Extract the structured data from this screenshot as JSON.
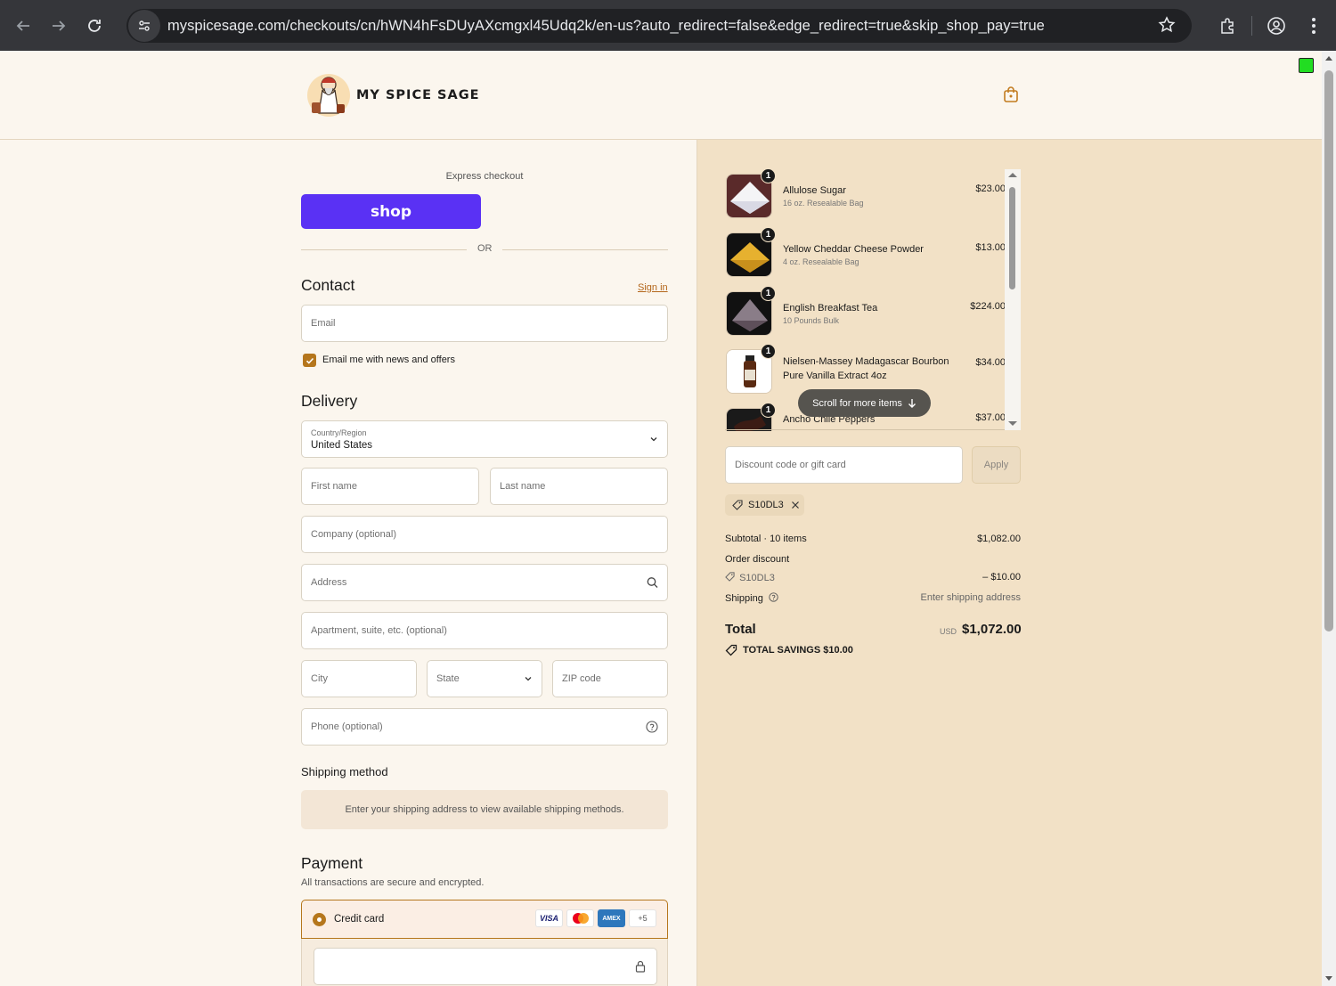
{
  "browser": {
    "url": "myspicesage.com/checkouts/cn/hWN4hFsDUyAXcmgxl45Udq2k/en-us?auto_redirect=false&edge_redirect=true&skip_shop_pay=true"
  },
  "header": {
    "logo_text": "MY SPICE SAGE",
    "cart_icon": "shopping-bag-icon"
  },
  "express": {
    "label": "Express checkout",
    "shop_button": "shop",
    "or": "OR"
  },
  "contact": {
    "title": "Contact",
    "sign_in": "Sign in",
    "email_placeholder": "Email",
    "newsletter_label": "Email me with news and offers",
    "newsletter_checked": true
  },
  "delivery": {
    "title": "Delivery",
    "country_label": "Country/Region",
    "country_value": "United States",
    "first_name": "First name",
    "last_name": "Last name",
    "company": "Company (optional)",
    "address": "Address",
    "apartment": "Apartment, suite, etc. (optional)",
    "city": "City",
    "state": "State",
    "zip": "ZIP code",
    "phone": "Phone (optional)"
  },
  "shipping_method": {
    "title": "Shipping method",
    "info": "Enter your shipping address to view available shipping methods."
  },
  "payment": {
    "title": "Payment",
    "subtitle": "All transactions are secure and encrypted.",
    "credit_card_label": "Credit card",
    "cards": [
      "VISA",
      "mastercard",
      "AMEX",
      "+5"
    ]
  },
  "order": {
    "items": [
      {
        "name": "Allulose Sugar",
        "variant": "16 oz. Resealable Bag",
        "price": "$23.00",
        "qty": "1"
      },
      {
        "name": "Yellow Cheddar Cheese Powder",
        "variant": "4 oz. Resealable Bag",
        "price": "$13.00",
        "qty": "1"
      },
      {
        "name": "English Breakfast Tea",
        "variant": "10 Pounds Bulk",
        "price": "$224.00",
        "qty": "1"
      },
      {
        "name": "Nielsen-Massey Madagascar Bourbon Pure Vanilla Extract 4oz",
        "variant": "",
        "price": "$34.00",
        "qty": "1"
      },
      {
        "name": "Ancho Chile Peppers",
        "variant": "",
        "price": "$37.00",
        "qty": "1"
      }
    ],
    "scroll_hint": "Scroll for more items",
    "discount_placeholder": "Discount code or gift card",
    "apply": "Apply",
    "applied_code": "S10DL3",
    "subtotal_label": "Subtotal · 10 items",
    "subtotal_value": "$1,082.00",
    "order_discount_label": "Order discount",
    "discount_code": "S10DL3",
    "discount_value": "– $10.00",
    "shipping_label": "Shipping",
    "shipping_value": "Enter shipping address",
    "total_label": "Total",
    "currency": "USD",
    "total_value": "$1,072.00",
    "savings": "TOTAL SAVINGS  $10.00"
  }
}
